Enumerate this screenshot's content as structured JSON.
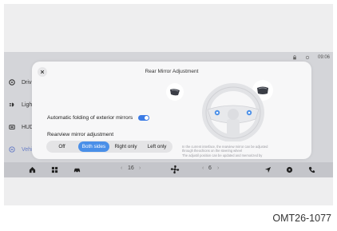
{
  "statusbar": {
    "time": "09:06"
  },
  "sidebar": {
    "items": [
      {
        "label": "Driv",
        "icon": "steering-icon"
      },
      {
        "label": "Ligh",
        "icon": "headlight-icon"
      },
      {
        "label": "HUD",
        "icon": "hud-icon"
      },
      {
        "label": "Vehi",
        "icon": "vehicle-icon"
      }
    ],
    "active_color": "#6a7fc7"
  },
  "dialog": {
    "title": "Rear Mirror Adjustment",
    "folding_label": "Automatic folding of exterior mirrors",
    "folding_on": true,
    "mirror_section_title": "Rearview mirror adjustment",
    "options": [
      "Off",
      "Both sides",
      "Right only",
      "Left only"
    ],
    "selected_option": "Both sides",
    "description": [
      "In the current interface, the rearview mirror can be adjusted",
      "through theochions on the steering wheel",
      "The adjustil position can be updated and memorized by"
    ],
    "accent_color": "#4a8fe8"
  },
  "dock": {
    "left_temp": "16",
    "right_temp": "6",
    "prev_chevron": "‹",
    "next_chevron": "›"
  },
  "caption": "OMT26-1077"
}
